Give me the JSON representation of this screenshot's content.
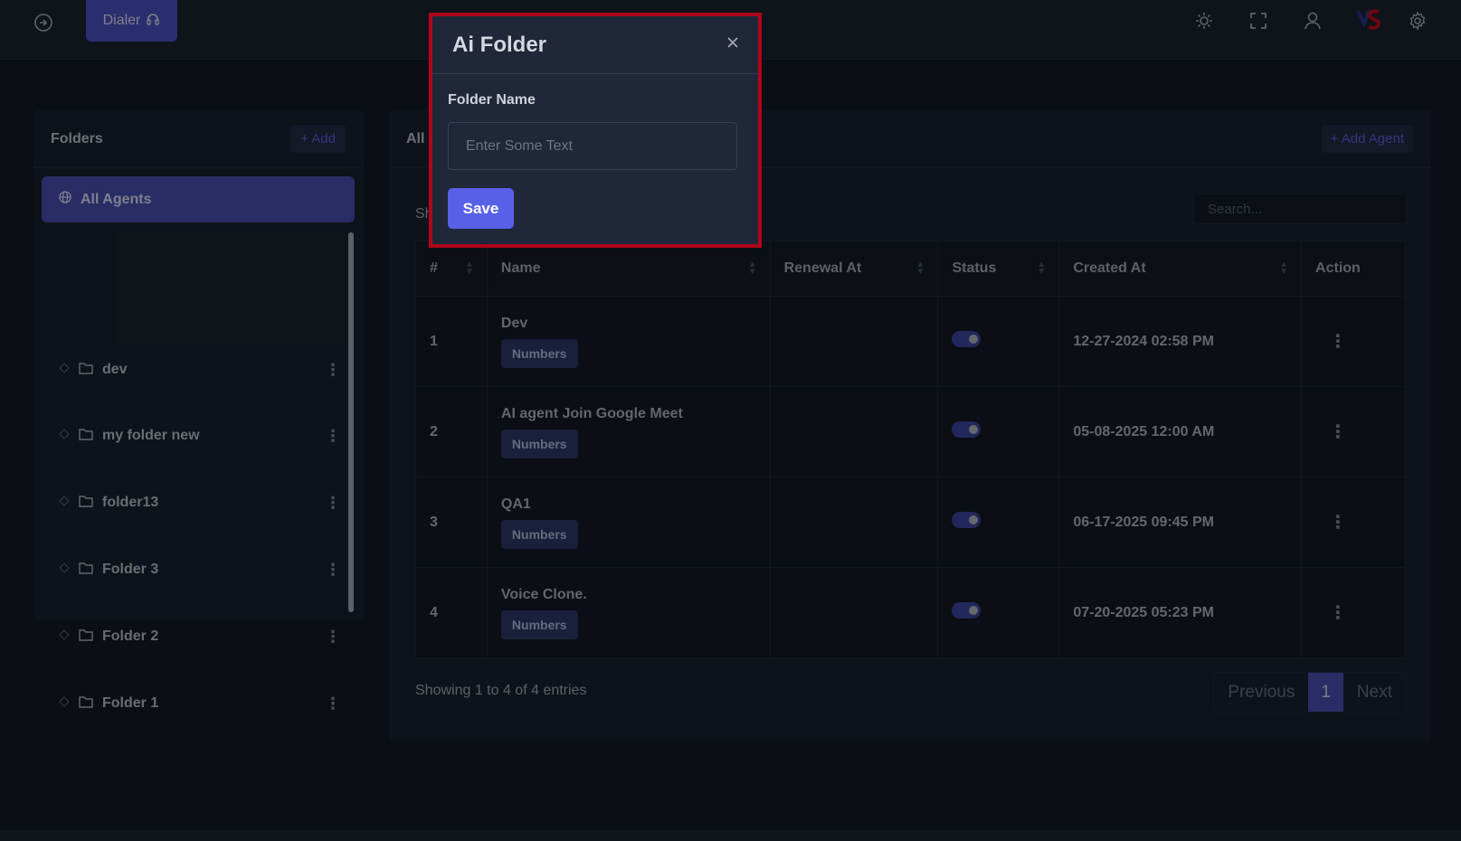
{
  "topbar": {
    "dialer_label": "Dialer",
    "icons": [
      "exit-circle-icon",
      "headset-icon",
      "sun-icon",
      "fullscreen-icon",
      "user-icon",
      "brand-logo",
      "gear-icon"
    ]
  },
  "folders": {
    "title": "Folders",
    "add_label": "+ Add",
    "all_agents_label": "All Agents",
    "items": [
      {
        "label": "dev"
      },
      {
        "label": "my folder new"
      },
      {
        "label": "folder13"
      },
      {
        "label": "Folder 3"
      },
      {
        "label": "Folder 2"
      },
      {
        "label": "Folder 1"
      }
    ]
  },
  "main": {
    "title_fragment": "All",
    "add_agent_label": "+ Add Agent",
    "show_fragment": "Sh",
    "search_placeholder": "Search...",
    "columns": [
      "#",
      "Name",
      "Renewal At",
      "Status",
      "Created At",
      "Action"
    ],
    "rows": [
      {
        "num": "1",
        "name": "Dev",
        "badge": "Numbers",
        "renewal": "",
        "status": true,
        "created": "12-27-2024 02:58 PM"
      },
      {
        "num": "2",
        "name": "AI agent Join Google Meet",
        "badge": "Numbers",
        "renewal": "",
        "status": true,
        "created": "05-08-2025 12:00 AM"
      },
      {
        "num": "3",
        "name": "QA1",
        "badge": "Numbers",
        "renewal": "",
        "status": true,
        "created": "06-17-2025 09:45 PM"
      },
      {
        "num": "4",
        "name": "Voice Clone.",
        "badge": "Numbers",
        "renewal": "",
        "status": true,
        "created": "07-20-2025 05:23 PM"
      }
    ],
    "entries_text": "Showing 1 to 4 of 4 entries",
    "pager": {
      "previous": "Previous",
      "current": "1",
      "next": "Next"
    }
  },
  "modal": {
    "title": "Ai Folder",
    "field_label": "Folder Name",
    "field_placeholder": "Enter Some Text",
    "field_value": "",
    "save_label": "Save"
  },
  "colors": {
    "accent": "#5960e8",
    "highlight_border": "#b0051b",
    "background": "#151b26"
  }
}
